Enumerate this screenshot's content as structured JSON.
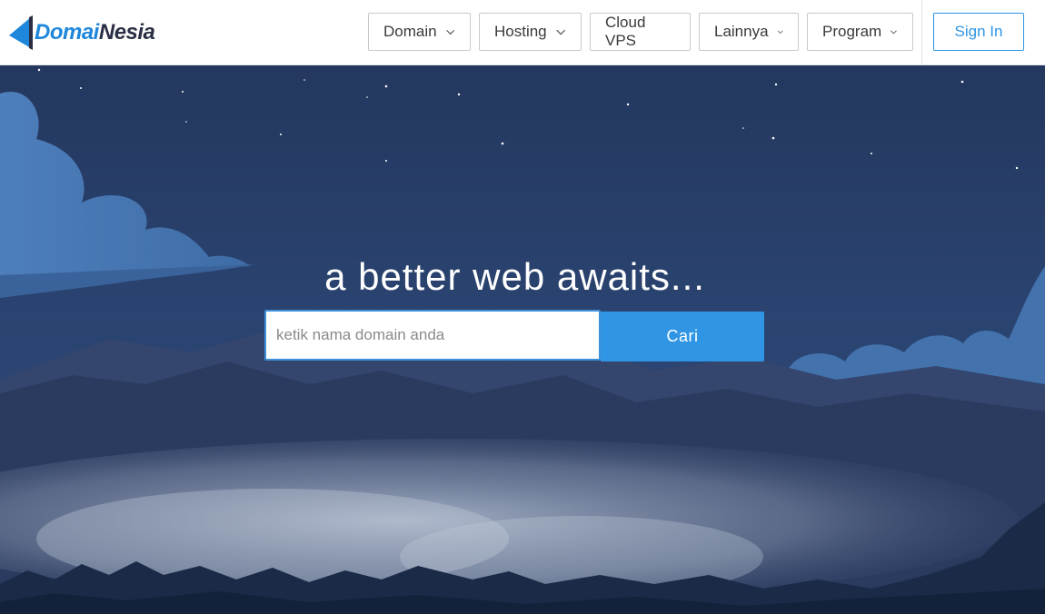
{
  "brand": {
    "name_part1": "Domai",
    "name_part2": "Nesia",
    "color_primary": "#1e87db",
    "color_dark": "#2a2f45"
  },
  "nav": {
    "items": [
      {
        "label": "Domain",
        "has_dropdown": true
      },
      {
        "label": "Hosting",
        "has_dropdown": true
      },
      {
        "label": "Cloud VPS",
        "has_dropdown": false
      },
      {
        "label": "Lainnya",
        "has_dropdown": true
      },
      {
        "label": "Program",
        "has_dropdown": true
      }
    ],
    "signin_label": "Sign In"
  },
  "hero": {
    "headline": "a better web awaits...",
    "search": {
      "value": "",
      "placeholder": "ketik nama domain anda",
      "button_label": "Cari"
    },
    "accent_color": "#2f95e4"
  },
  "icons": [
    "logo-triangle-icon",
    "chevron-down-icon"
  ]
}
